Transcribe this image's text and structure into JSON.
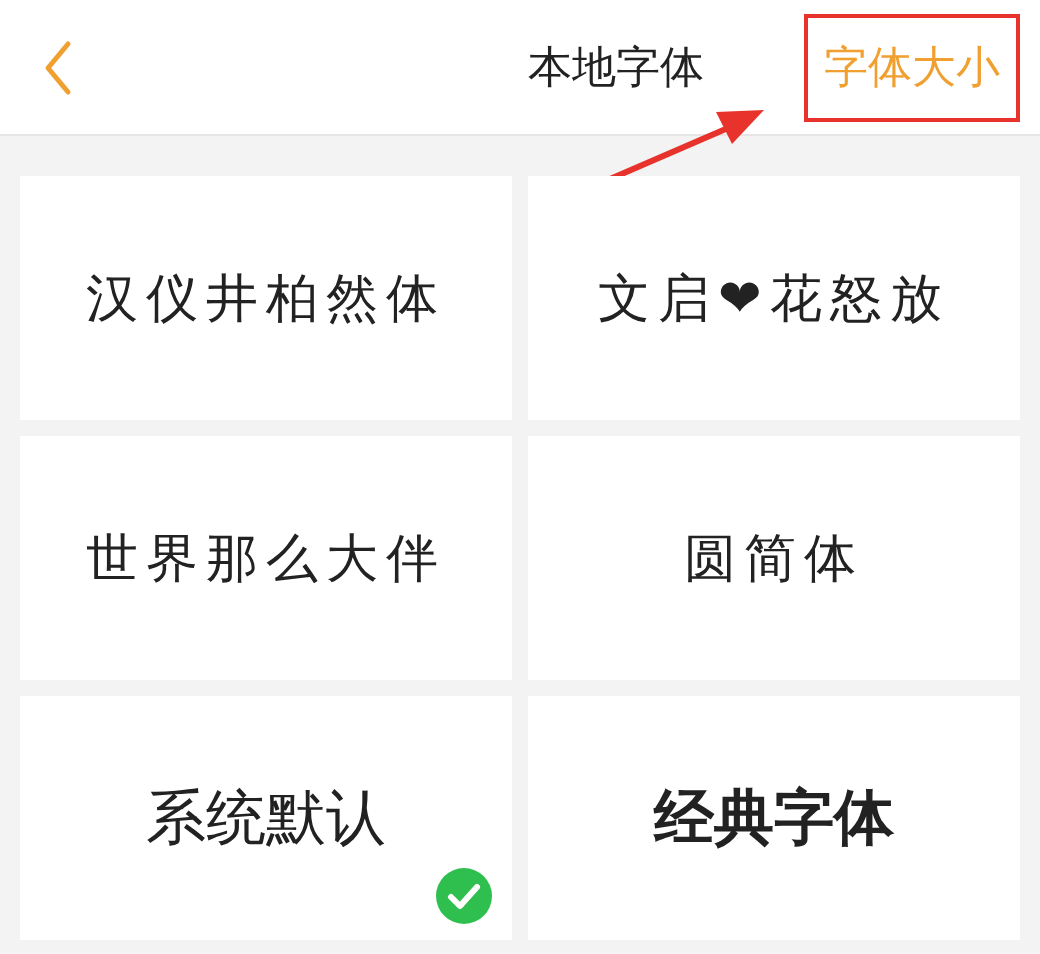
{
  "header": {
    "title": "本地字体",
    "action": "字体大小",
    "action_highlighted": true
  },
  "fonts": [
    {
      "label": "汉仪井柏然体",
      "kind": "handwritten",
      "selected": false
    },
    {
      "label": "文启❤花怒放",
      "kind": "handwritten",
      "selected": false
    },
    {
      "label": "世界那么大伴",
      "kind": "handwritten",
      "selected": false
    },
    {
      "label": "圆简体",
      "kind": "handwritten",
      "selected": false
    },
    {
      "label": "系统默认",
      "kind": "standard",
      "selected": true
    },
    {
      "label": "经典字体",
      "kind": "bold",
      "selected": false
    }
  ]
}
